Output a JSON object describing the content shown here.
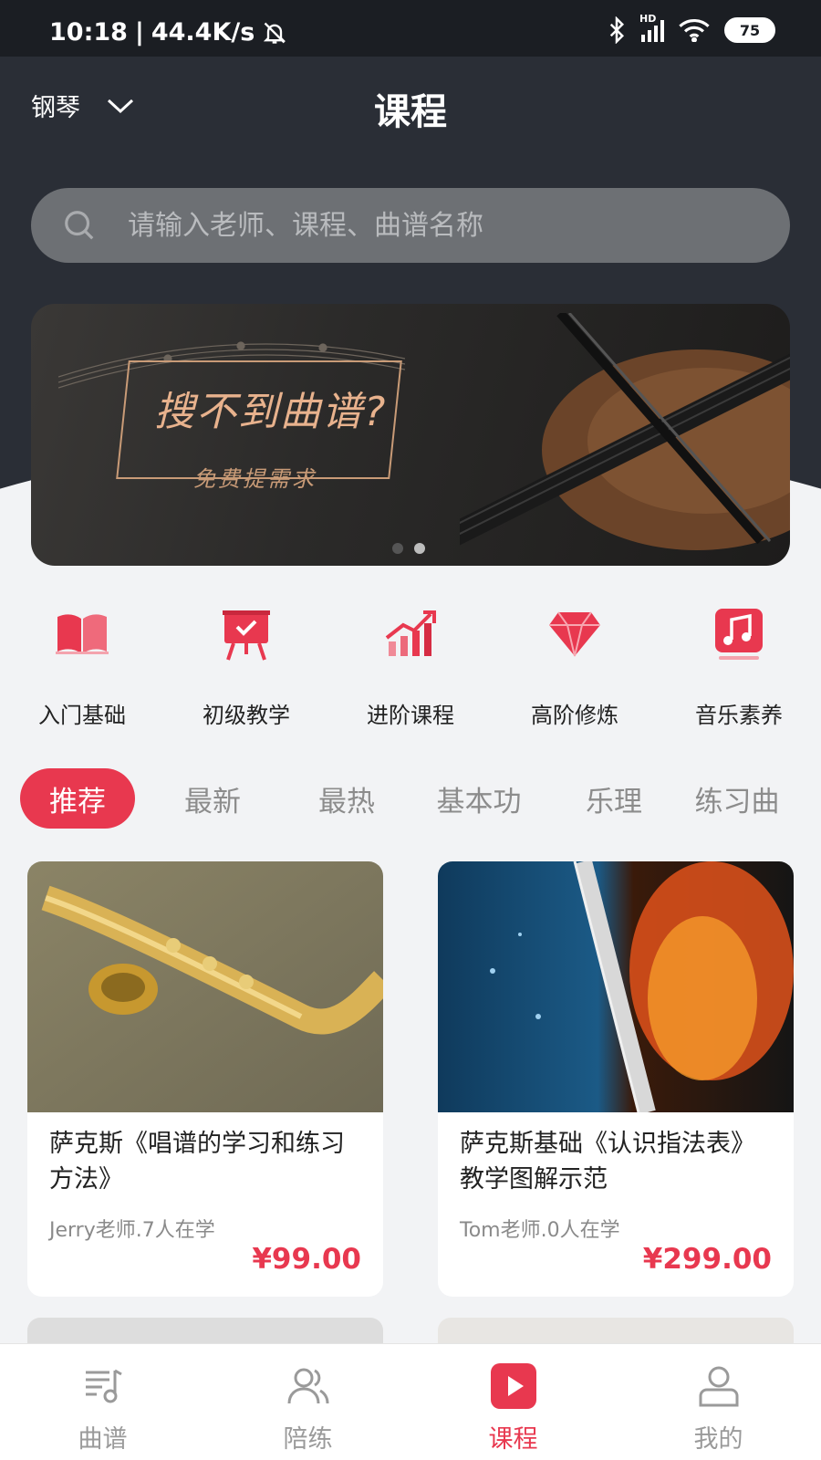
{
  "status_bar": {
    "time": "10:18",
    "separator": "|",
    "speed": "44.4K/s",
    "network": "HD",
    "battery": "75"
  },
  "header": {
    "instrument": "钢琴",
    "title": "课程"
  },
  "search": {
    "placeholder": "请输入老师、课程、曲谱名称"
  },
  "banner": {
    "title": "搜不到曲谱?",
    "subtitle": "免费提需求",
    "page_count": 2,
    "active_index": 0
  },
  "categories": [
    {
      "label": "入门基础",
      "icon": "book-icon"
    },
    {
      "label": "初级教学",
      "icon": "easel-icon"
    },
    {
      "label": "进阶课程",
      "icon": "bar-chart-icon"
    },
    {
      "label": "高阶修炼",
      "icon": "diamond-icon"
    },
    {
      "label": "音乐素养",
      "icon": "music-note-icon"
    }
  ],
  "tabs": [
    "推荐",
    "最新",
    "最热",
    "基本功",
    "乐理",
    "练习曲"
  ],
  "courses": [
    {
      "title": "萨克斯《唱谱的学习和练习方法》",
      "meta": "Jerry老师.7人在学",
      "price": "¥99.00"
    },
    {
      "title": "萨克斯基础《认识指法表》教学图解示范",
      "meta": "Tom老师.0人在学",
      "price": "¥299.00"
    }
  ],
  "bottom_nav": [
    {
      "label": "曲谱",
      "icon": "score-icon"
    },
    {
      "label": "陪练",
      "icon": "users-icon"
    },
    {
      "label": "课程",
      "icon": "play-icon"
    },
    {
      "label": "我的",
      "icon": "user-icon"
    }
  ],
  "colors": {
    "accent": "#e8384f",
    "header_bg": "#2a2e36",
    "page_bg": "#f2f3f5"
  }
}
